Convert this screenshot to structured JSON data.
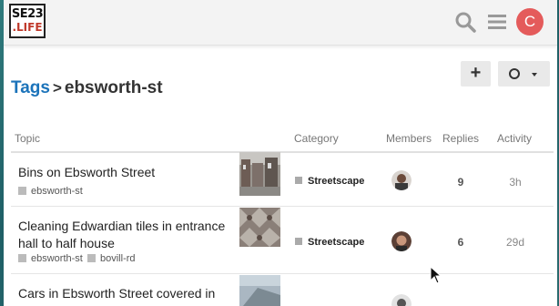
{
  "header": {
    "logo_line1": "SE23",
    "logo_line2": ".LIFE",
    "search_icon": "search-icon",
    "menu_icon": "hamburger-menu-icon",
    "user_initial": "C",
    "user_avatar_color": "#e45b5b"
  },
  "breadcrumb": {
    "parent": "Tags",
    "separator": ">",
    "current": "ebsworth-st"
  },
  "toolbar": {
    "create_label": "+",
    "notification_icon": "circle-notification-icon"
  },
  "columns": {
    "topic": "Topic",
    "category": "Category",
    "members": "Members",
    "replies": "Replies",
    "activity": "Activity"
  },
  "topics": [
    {
      "title": "Bins on Ebsworth Street",
      "tags": [
        "ebsworth-st"
      ],
      "category": "Streetscape",
      "replies": "9",
      "activity": "3h"
    },
    {
      "title": "Cleaning Edwardian tiles in entrance hall to half house",
      "tags": [
        "ebsworth-st",
        "bovill-rd"
      ],
      "category": "Streetscape",
      "replies": "6",
      "activity": "29d"
    },
    {
      "title": "Cars in Ebsworth Street covered in",
      "tags": [],
      "category": "",
      "replies": "",
      "activity": ""
    }
  ],
  "colors": {
    "link_blue": "#1b73ba",
    "button_bg": "#e9e9e9",
    "category_swatch": "#aaaaaa",
    "tag_swatch": "#bbbbbb"
  }
}
